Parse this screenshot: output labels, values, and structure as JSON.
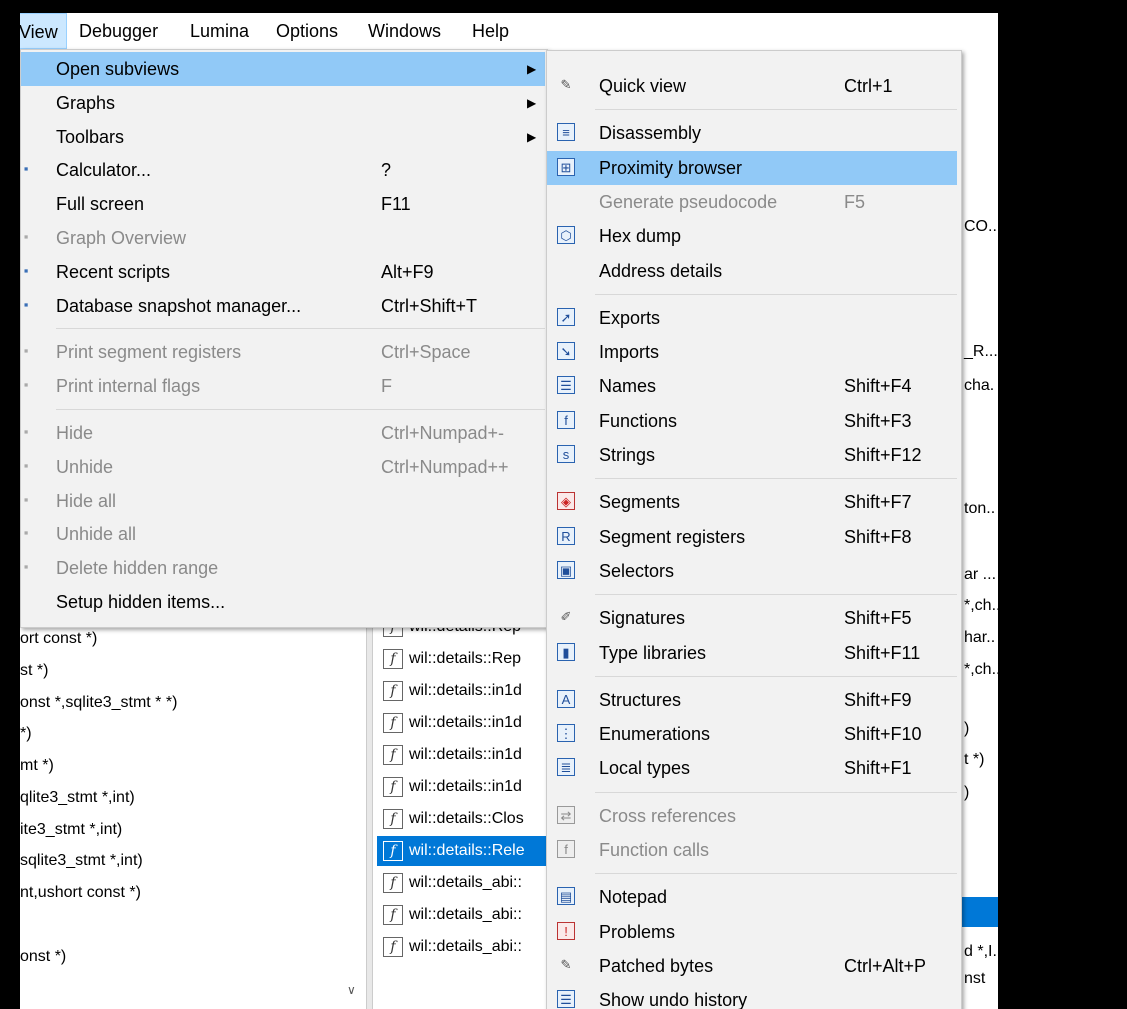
{
  "menubar": [
    {
      "label": "View",
      "name": "menubar-view"
    },
    {
      "label": "Debugger",
      "name": "menubar-debugger"
    },
    {
      "label": "Lumina",
      "name": "menubar-lumina"
    },
    {
      "label": "Options",
      "name": "menubar-options"
    },
    {
      "label": "Windows",
      "name": "menubar-windows"
    },
    {
      "label": "Help",
      "name": "menubar-help"
    }
  ],
  "view_menu": [
    {
      "label": "Open subviews",
      "shortcut": "",
      "submenu": true,
      "highlighted": true,
      "disabled": false,
      "icon": ""
    },
    {
      "label": "Graphs",
      "shortcut": "",
      "submenu": true,
      "disabled": false,
      "icon": ""
    },
    {
      "label": "Toolbars",
      "shortcut": "",
      "submenu": true,
      "disabled": false,
      "icon": ""
    },
    {
      "label": "Calculator...",
      "shortcut": "?",
      "disabled": false,
      "icon": "calculator-icon"
    },
    {
      "label": "Full screen",
      "shortcut": "F11",
      "disabled": false,
      "icon": ""
    },
    {
      "label": "Graph Overview",
      "shortcut": "",
      "disabled": true,
      "icon": "graph-overview-icon"
    },
    {
      "label": "Recent scripts",
      "shortcut": "Alt+F9",
      "disabled": false,
      "icon": "recent-scripts-icon"
    },
    {
      "label": "Database snapshot manager...",
      "shortcut": "Ctrl+Shift+T",
      "disabled": false,
      "icon": "snapshot-icon"
    },
    {
      "separator": true
    },
    {
      "label": "Print segment registers",
      "shortcut": "Ctrl+Space",
      "disabled": true,
      "icon": "segment-registers-icon"
    },
    {
      "label": "Print internal flags",
      "shortcut": "F",
      "disabled": true,
      "icon": "info-icon"
    },
    {
      "separator": true
    },
    {
      "label": "Hide",
      "shortcut": "Ctrl+Numpad+-",
      "disabled": true,
      "icon": "hide-icon"
    },
    {
      "label": "Unhide",
      "shortcut": "Ctrl+Numpad++",
      "disabled": true,
      "icon": "unhide-icon"
    },
    {
      "label": "Hide all",
      "shortcut": "",
      "disabled": true,
      "icon": "hide-all-icon"
    },
    {
      "label": "Unhide all",
      "shortcut": "",
      "disabled": true,
      "icon": "unhide-all-icon"
    },
    {
      "label": "Delete hidden range",
      "shortcut": "",
      "disabled": true,
      "icon": "delete-icon"
    },
    {
      "label": "Setup hidden items...",
      "shortcut": "",
      "disabled": false,
      "icon": ""
    }
  ],
  "subviews_menu": [
    {
      "label": "Quick view",
      "shortcut": "Ctrl+1",
      "icon": "quick-view-icon",
      "glyph": "✎"
    },
    {
      "separator": true
    },
    {
      "label": "Disassembly",
      "shortcut": "",
      "icon": "disassembly-icon",
      "glyph": "≡"
    },
    {
      "label": "Proximity browser",
      "shortcut": "",
      "icon": "proximity-browser-icon",
      "glyph": "⊞",
      "highlighted": true
    },
    {
      "label": "Generate pseudocode",
      "shortcut": "F5",
      "icon": "",
      "glyph": "",
      "disabled": true
    },
    {
      "label": "Hex dump",
      "shortcut": "",
      "icon": "hex-dump-icon",
      "glyph": "⬡"
    },
    {
      "label": "Address details",
      "shortcut": "",
      "icon": "",
      "glyph": ""
    },
    {
      "separator": true
    },
    {
      "label": "Exports",
      "shortcut": "",
      "icon": "exports-icon",
      "glyph": "➚"
    },
    {
      "label": "Imports",
      "shortcut": "",
      "icon": "imports-icon",
      "glyph": "➘"
    },
    {
      "label": "Names",
      "shortcut": "Shift+F4",
      "icon": "names-icon",
      "glyph": "☰"
    },
    {
      "label": "Functions",
      "shortcut": "Shift+F3",
      "icon": "functions-icon",
      "glyph": "f"
    },
    {
      "label": "Strings",
      "shortcut": "Shift+F12",
      "icon": "strings-icon",
      "glyph": "s"
    },
    {
      "separator": true
    },
    {
      "label": "Segments",
      "shortcut": "Shift+F7",
      "icon": "segments-icon",
      "glyph": "◈"
    },
    {
      "label": "Segment registers",
      "shortcut": "Shift+F8",
      "icon": "segment-registers-icon",
      "glyph": "R"
    },
    {
      "label": "Selectors",
      "shortcut": "",
      "icon": "selectors-icon",
      "glyph": "▣"
    },
    {
      "separator": true
    },
    {
      "label": "Signatures",
      "shortcut": "Shift+F5",
      "icon": "signatures-icon",
      "glyph": "✐"
    },
    {
      "label": "Type libraries",
      "shortcut": "Shift+F11",
      "icon": "type-libraries-icon",
      "glyph": "▮"
    },
    {
      "separator": true
    },
    {
      "label": "Structures",
      "shortcut": "Shift+F9",
      "icon": "structures-icon",
      "glyph": "A"
    },
    {
      "label": "Enumerations",
      "shortcut": "Shift+F10",
      "icon": "enumerations-icon",
      "glyph": "⋮"
    },
    {
      "label": "Local types",
      "shortcut": "Shift+F1",
      "icon": "local-types-icon",
      "glyph": "≣"
    },
    {
      "separator": true
    },
    {
      "label": "Cross references",
      "shortcut": "",
      "icon": "cross-references-icon",
      "glyph": "⇄",
      "disabled": true
    },
    {
      "label": "Function calls",
      "shortcut": "",
      "icon": "function-calls-icon",
      "glyph": "f",
      "disabled": true
    },
    {
      "separator": true
    },
    {
      "label": "Notepad",
      "shortcut": "",
      "icon": "notepad-icon",
      "glyph": "▤"
    },
    {
      "label": "Problems",
      "shortcut": "",
      "icon": "problems-icon",
      "glyph": "!"
    },
    {
      "label": "Patched bytes",
      "shortcut": "Ctrl+Alt+P",
      "icon": "patched-bytes-icon",
      "glyph": "✎"
    },
    {
      "label": "Show undo history",
      "shortcut": "",
      "icon": "undo-history-icon",
      "glyph": "☰"
    }
  ],
  "background": {
    "left_code": [
      "ort const *)",
      "st *)",
      "onst *,sqlite3_stmt * *)",
      " *)",
      "mt *)",
      "qlite3_stmt *,int)",
      "ite3_stmt *,int)",
      "sqlite3_stmt *,int)",
      "nt,ushort const *)",
      "",
      "onst *)"
    ],
    "function_list": [
      "wil::details::Rep",
      "wil::details::Rep",
      "wil::details::Rep",
      "wil::details::in1d",
      "wil::details::in1d",
      "wil::details::in1d",
      "wil::details::in1d",
      "wil::details::Clos",
      "wil::details::Rele",
      "wil::details_abi::",
      "wil::details_abi::",
      "wil::details_abi::"
    ],
    "right_code": [
      "CO...",
      "_R...",
      "cha.",
      "ton..",
      "ar ...",
      "*,ch...",
      "har..",
      "*,ch...",
      ")",
      "t *)",
      ")",
      "ort ...",
      "d *,I.",
      "nst"
    ]
  }
}
